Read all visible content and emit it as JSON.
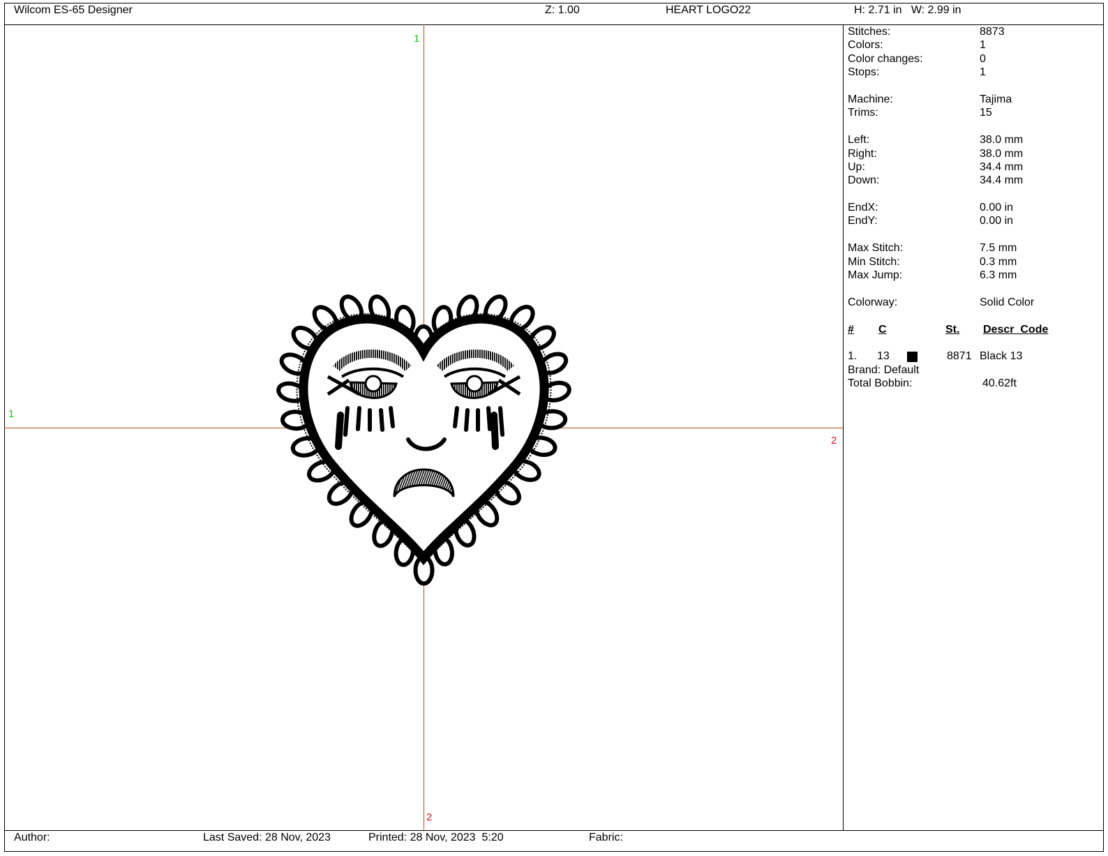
{
  "header": {
    "app_title": "Wilcom ES-65 Designer",
    "zoom": "Z: 1.00",
    "design_name": "HEART LOGO22",
    "size": "H: 2.71 in   W: 2.99 in"
  },
  "guides": {
    "top_mark": "1",
    "left_mark": "1",
    "right_mark": "2",
    "bottom_mark": "2"
  },
  "stats": {
    "stitches_label": "Stitches:",
    "stitches": "8873",
    "colors_label": "Colors:",
    "colors": "1",
    "color_changes_label": "Color changes:",
    "color_changes": "0",
    "stops_label": "Stops:",
    "stops": "1",
    "machine_label": "Machine:",
    "machine": "Tajima",
    "trims_label": "Trims:",
    "trims": "15",
    "left_label": "Left:",
    "left": "38.0 mm",
    "right_label": "Right:",
    "right": "38.0 mm",
    "up_label": "Up:",
    "up": "34.4 mm",
    "down_label": "Down:",
    "down": "34.4 mm",
    "endx_label": "EndX:",
    "endx": "0.00 in",
    "endy_label": "EndY:",
    "endy": "0.00 in",
    "max_stitch_label": "Max Stitch:",
    "max_stitch": "7.5 mm",
    "min_stitch_label": "Min Stitch:",
    "min_stitch": "0.3 mm",
    "max_jump_label": "Max Jump:",
    "max_jump": "6.3 mm",
    "colorway_label": "Colorway:",
    "colorway": "Solid Color"
  },
  "color_table": {
    "headers": {
      "num": "#",
      "color": "C",
      "stitches": "St.",
      "descr": "Descr  Code"
    },
    "rows": [
      {
        "num": "1.",
        "color": "13",
        "swatch": "#000000",
        "stitches": "8871",
        "descr": "Black 13"
      }
    ],
    "brand": "Brand: Default",
    "total_bobbin_label": "Total Bobbin:",
    "total_bobbin": "40.62ft"
  },
  "footer": {
    "author": "Author:",
    "last_saved": "Last Saved: 28 Nov, 2023",
    "printed": "Printed: 28 Nov, 2023  5:20",
    "fabric": "Fabric:"
  },
  "colors": {
    "guide": "#b5501f",
    "mark_green": "#22bb22",
    "mark_red": "#d21a30",
    "thread": "#000000"
  }
}
